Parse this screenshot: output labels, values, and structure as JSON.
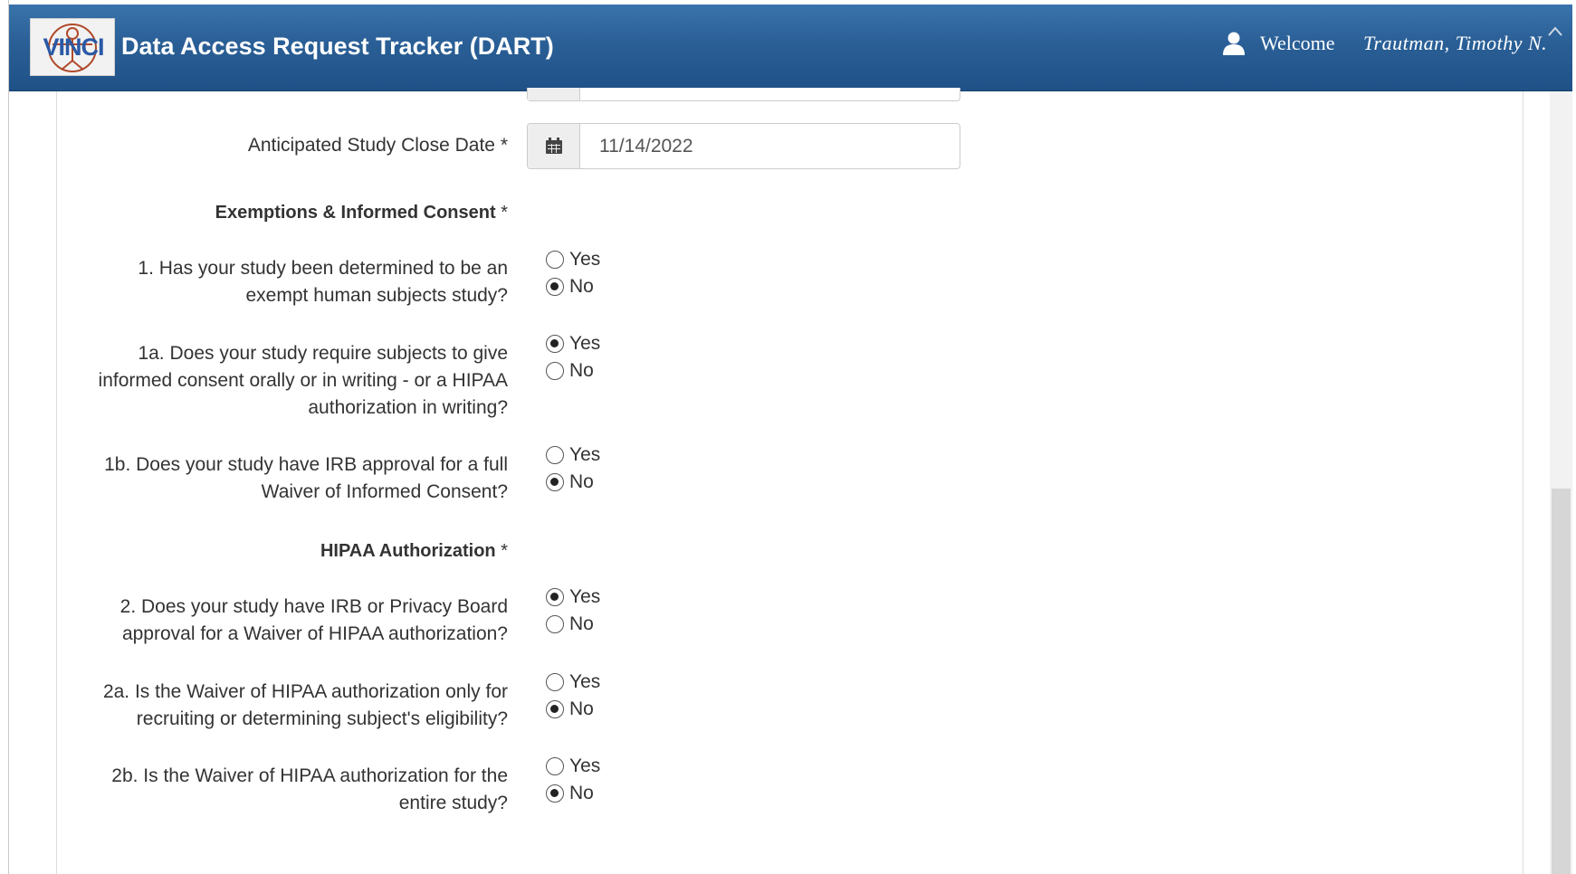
{
  "header": {
    "logo_text": "VINCI",
    "title": "Data Access Request Tracker (DART)",
    "welcome": "Welcome",
    "user_name": "Trautman,  Timothy  N."
  },
  "form": {
    "close_date": {
      "label": "Anticipated Study Close Date",
      "required_marker": "*",
      "value": "11/14/2022"
    },
    "sections": {
      "exemptions": "Exemptions & Informed Consent",
      "hipaa": "HIPAA Authorization"
    },
    "required_marker": "*",
    "questions": [
      {
        "id": "q1",
        "lines": [
          "1. Has your study been determined to be an",
          "exempt human subjects study?"
        ],
        "selected": "No"
      },
      {
        "id": "q1a",
        "lines": [
          "1a. Does your study require subjects to give",
          "informed consent orally or in writing - or a HIPAA",
          "authorization in writing?"
        ],
        "selected": "Yes"
      },
      {
        "id": "q1b",
        "lines": [
          "1b. Does your study have IRB approval for a full",
          "Waiver of Informed Consent?"
        ],
        "selected": "No"
      },
      {
        "id": "q2",
        "lines": [
          "2. Does your study have IRB or Privacy Board",
          "approval for a Waiver of HIPAA authorization?"
        ],
        "selected": "Yes"
      },
      {
        "id": "q2a",
        "lines": [
          "2a. Is the Waiver of HIPAA authorization only for",
          "recruiting or determining subject's eligibility?"
        ],
        "selected": "No"
      },
      {
        "id": "q2b",
        "lines": [
          "2b. Is the Waiver of HIPAA authorization for the",
          "entire study?"
        ],
        "selected": "No"
      }
    ],
    "options": {
      "yes": "Yes",
      "no": "No"
    }
  },
  "colors": {
    "header_top": "#3a73ab",
    "header_bottom": "#1f5187",
    "logo_text": "#2a59a6"
  },
  "icons": {
    "user": "user-icon",
    "calendar": "calendar-icon",
    "logo": "vinci-logo-icon",
    "collapse": "chevron-up-icon"
  }
}
